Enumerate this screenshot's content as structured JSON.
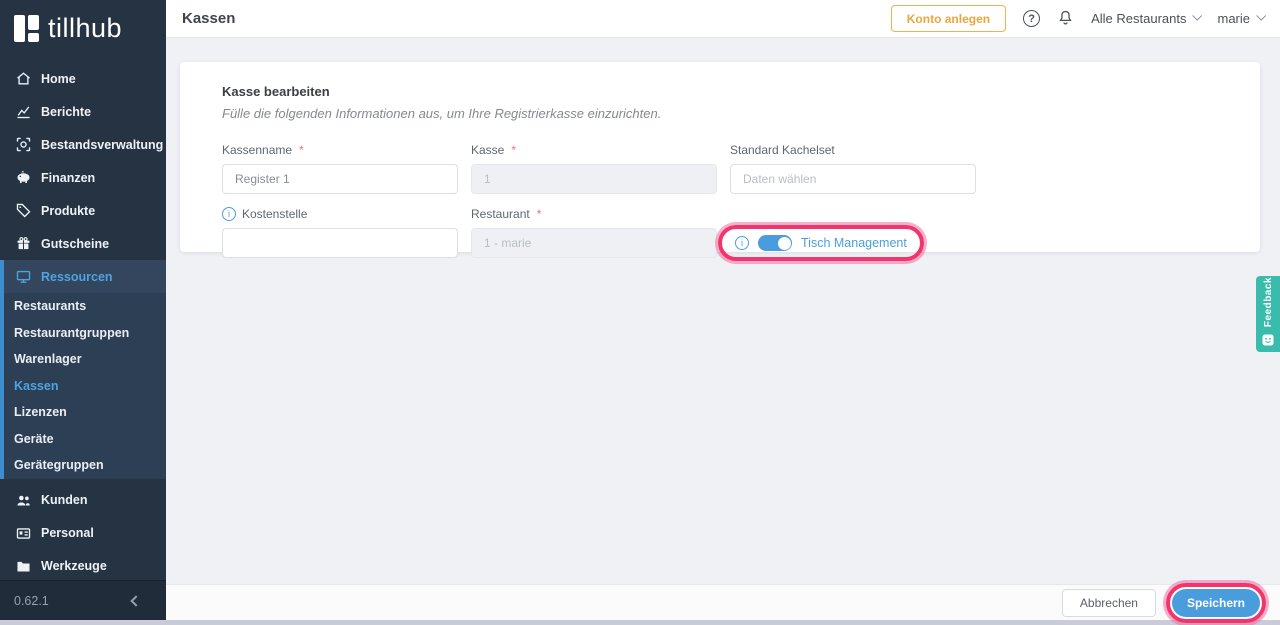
{
  "app": {
    "logo_text": "tillhub",
    "version": "0.62.1"
  },
  "header": {
    "page_title": "Kassen",
    "konto_anlegen_label": "Konto anlegen",
    "restaurant_filter_label": "Alle Restaurants",
    "user_menu_label": "marie"
  },
  "sidebar": {
    "items": [
      {
        "label": "Home",
        "icon": "home-icon"
      },
      {
        "label": "Berichte",
        "icon": "chart-icon"
      },
      {
        "label": "Bestandsverwaltung",
        "icon": "inventory-icon"
      },
      {
        "label": "Finanzen",
        "icon": "piggy-bank-icon"
      },
      {
        "label": "Produkte",
        "icon": "tag-icon"
      },
      {
        "label": "Gutscheine",
        "icon": "voucher-icon"
      },
      {
        "label": "Ressourcen",
        "icon": "monitor-icon",
        "active": true,
        "expanded": true
      }
    ],
    "ressourcen_children": [
      {
        "label": "Restaurants"
      },
      {
        "label": "Restaurantgruppen"
      },
      {
        "label": "Warenlager"
      },
      {
        "label": "Kassen",
        "active": true
      },
      {
        "label": "Lizenzen"
      },
      {
        "label": "Geräte"
      },
      {
        "label": "Gerätegruppen"
      }
    ],
    "items_bottom": [
      {
        "label": "Kunden",
        "icon": "users-icon"
      },
      {
        "label": "Personal",
        "icon": "id-badge-icon"
      },
      {
        "label": "Werkzeuge",
        "icon": "folder-icon"
      }
    ]
  },
  "form": {
    "title": "Kasse bearbeiten",
    "subtitle": "Fülle die folgenden Informationen aus, um Ihre Registrierkasse einzurichten.",
    "required_mark": "*",
    "fields": {
      "kassenname": {
        "label": "Kassenname",
        "value": "Register 1",
        "required": true
      },
      "kasse": {
        "label": "Kasse",
        "value": "1",
        "required": true,
        "disabled": true
      },
      "kachelset": {
        "label": "Standard Kachelset",
        "placeholder": "Daten wählen"
      },
      "kostenstelle": {
        "label": "Kostenstelle",
        "value": ""
      },
      "restaurant": {
        "label": "Restaurant",
        "value": "1 - marie",
        "required": true,
        "disabled": true
      },
      "tisch_management": {
        "label": "Tisch Management",
        "enabled": true
      }
    }
  },
  "actions": {
    "cancel_label": "Abbrechen",
    "save_label": "Speichern"
  },
  "feedback_tab": {
    "label": "Feedback"
  },
  "colors": {
    "accent_blue": "#4a9ddd",
    "highlight_pink": "#f2356d",
    "sidebar_bg": "#253343",
    "active_blue_text": "#4da3e0",
    "warning_orange": "#eca63c",
    "feedback_teal": "#3abcad"
  }
}
